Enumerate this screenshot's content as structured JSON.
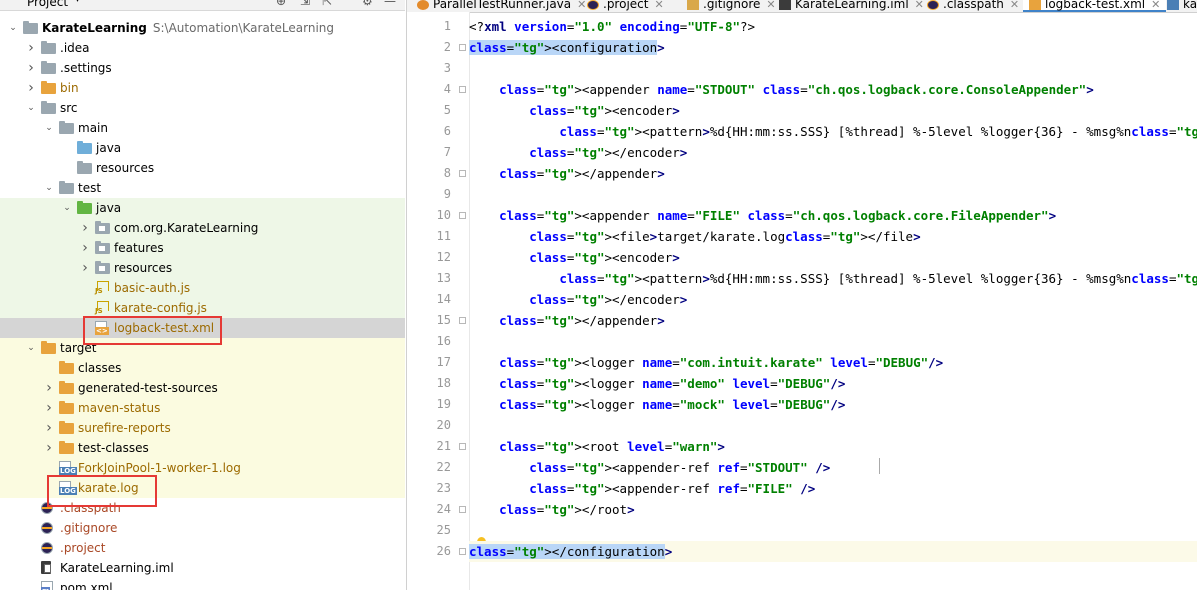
{
  "project_panel": {
    "title": "Project",
    "tree": [
      {
        "label": "KarateLearning",
        "path": "S:\\Automation\\KarateLearning",
        "icon": "module-folder-icon",
        "twisty": "expanded"
      },
      {
        "label": ".idea",
        "icon": "folder-icon",
        "twisty": "collapsed"
      },
      {
        "label": ".settings",
        "icon": "folder-icon",
        "twisty": "collapsed"
      },
      {
        "label": "bin",
        "icon": "excluded-folder-icon",
        "twisty": "collapsed"
      },
      {
        "label": "src",
        "icon": "folder-icon",
        "twisty": "expanded"
      },
      {
        "label": "main",
        "icon": "folder-icon",
        "twisty": "expanded"
      },
      {
        "label": "java",
        "icon": "source-folder-icon",
        "twisty": ""
      },
      {
        "label": "resources",
        "icon": "resources-folder-icon",
        "twisty": ""
      },
      {
        "label": "test",
        "icon": "folder-icon",
        "twisty": "expanded"
      },
      {
        "label": "java",
        "icon": "test-source-folder-icon",
        "twisty": "expanded"
      },
      {
        "label": "com.org.KarateLearning",
        "icon": "package-icon",
        "twisty": "collapsed"
      },
      {
        "label": "features",
        "icon": "package-icon",
        "twisty": "collapsed"
      },
      {
        "label": "resources",
        "icon": "package-icon",
        "twisty": "collapsed"
      },
      {
        "label": "basic-auth.js",
        "icon": "js-file-icon",
        "twisty": ""
      },
      {
        "label": "karate-config.js",
        "icon": "js-file-icon",
        "twisty": ""
      },
      {
        "label": "logback-test.xml",
        "icon": "xml-file-icon",
        "twisty": ""
      },
      {
        "label": "target",
        "icon": "excluded-folder-icon",
        "twisty": "expanded"
      },
      {
        "label": "classes",
        "icon": "excluded-folder-icon",
        "twisty": ""
      },
      {
        "label": "generated-test-sources",
        "icon": "excluded-folder-icon",
        "twisty": "collapsed"
      },
      {
        "label": "maven-status",
        "icon": "excluded-folder-icon",
        "twisty": "collapsed"
      },
      {
        "label": "surefire-reports",
        "icon": "excluded-folder-icon",
        "twisty": "collapsed"
      },
      {
        "label": "test-classes",
        "icon": "excluded-folder-icon",
        "twisty": "collapsed"
      },
      {
        "label": "ForkJoinPool-1-worker-1.log",
        "icon": "log-file-icon",
        "twisty": ""
      },
      {
        "label": "karate.log",
        "icon": "log-file-icon",
        "twisty": ""
      },
      {
        "label": ".classpath",
        "icon": "eclipse-file-icon",
        "twisty": ""
      },
      {
        "label": ".gitignore",
        "icon": "eclipse-file-icon",
        "twisty": ""
      },
      {
        "label": ".project",
        "icon": "eclipse-file-icon",
        "twisty": ""
      },
      {
        "label": "KarateLearning.iml",
        "icon": "iml-file-icon",
        "twisty": ""
      },
      {
        "label": "pom.xml",
        "icon": "maven-file-icon",
        "twisty": ""
      }
    ]
  },
  "editor": {
    "tabs": [
      {
        "label": "ParallelTestRunner.java",
        "icon": "java-icon"
      },
      {
        "label": ".project",
        "icon": "eclipse-icon"
      },
      {
        "label": ".gitignore",
        "icon": "git-icon"
      },
      {
        "label": "KarateLearning.iml",
        "icon": "iml-icon"
      },
      {
        "label": ".classpath",
        "icon": "eclipse-icon"
      },
      {
        "label": "logback-test.xml",
        "icon": "xml-icon",
        "active": true
      },
      {
        "label": "karate.log",
        "icon": "log-icon"
      }
    ],
    "line_numbers": [
      "1",
      "2",
      "3",
      "4",
      "5",
      "6",
      "7",
      "8",
      "9",
      "10",
      "11",
      "12",
      "13",
      "14",
      "15",
      "16",
      "17",
      "18",
      "19",
      "20",
      "21",
      "22",
      "23",
      "24",
      "25",
      "26"
    ],
    "lines": [
      "<?xml version=\"1.0\" encoding=\"UTF-8\"?>",
      "<configuration>",
      "",
      "    <appender name=\"STDOUT\" class=\"ch.qos.logback.core.ConsoleAppender\">",
      "        <encoder>",
      "            <pattern>%d{HH:mm:ss.SSS} [%thread] %-5level %logger{36} - %msg%n</pattern>",
      "        </encoder>",
      "    </appender>",
      "",
      "    <appender name=\"FILE\" class=\"ch.qos.logback.core.FileAppender\">",
      "        <file>target/karate.log</file>",
      "        <encoder>",
      "            <pattern>%d{HH:mm:ss.SSS} [%thread] %-5level %logger{36} - %msg%n</pattern>",
      "        </encoder>",
      "    </appender>",
      "",
      "    <logger name=\"com.intuit.karate\" level=\"DEBUG\"/>",
      "    <logger name=\"demo\" level=\"DEBUG\"/>",
      "    <logger name=\"mock\" level=\"DEBUG\"/>",
      "",
      "    <root level=\"warn\">",
      "        <appender-ref ref=\"STDOUT\" />",
      "        <appender-ref ref=\"FILE\" />",
      "    </root>",
      "",
      "</configuration>"
    ]
  }
}
